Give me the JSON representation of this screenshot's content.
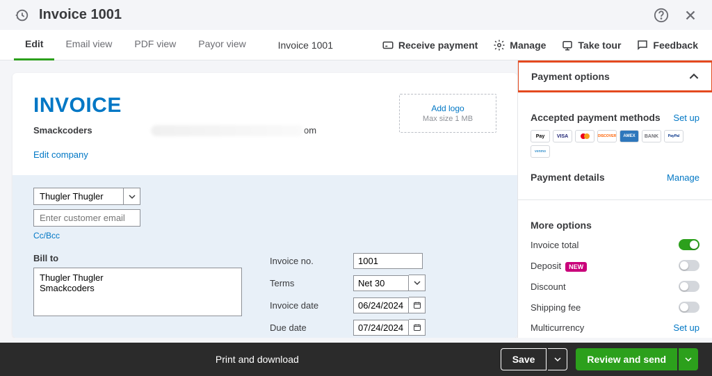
{
  "header": {
    "title": "Invoice 1001"
  },
  "tabs": {
    "items": [
      "Edit",
      "Email view",
      "PDF view",
      "Payor view"
    ],
    "center": "Invoice 1001",
    "actions": {
      "receive": "Receive payment",
      "manage": "Manage",
      "tour": "Take tour",
      "feedback": "Feedback"
    }
  },
  "invoice": {
    "title": "INVOICE",
    "company": "Smackcoders",
    "email_suffix": "om",
    "edit_company": "Edit company",
    "logo": {
      "add": "Add logo",
      "hint": "Max size  1 MB"
    },
    "customer": "Thugler Thugler",
    "email_placeholder": "Enter customer email",
    "ccbcc": "Cc/Bcc",
    "bill_to_label": "Bill to",
    "bill_to": "Thugler Thugler\nSmackcoders",
    "fields": {
      "invoice_no": {
        "label": "Invoice no.",
        "value": "1001"
      },
      "terms": {
        "label": "Terms",
        "value": "Net 30"
      },
      "invoice_date": {
        "label": "Invoice date",
        "value": "06/24/2024"
      },
      "due_date": {
        "label": "Due date",
        "value": "07/24/2024"
      }
    }
  },
  "panel": {
    "payment_options": "Payment options",
    "accepted": {
      "label": "Accepted payment methods",
      "setup": "Set up"
    },
    "payment_details": {
      "label": "Payment details",
      "manage": "Manage"
    },
    "more": "More options",
    "opts": {
      "total": "Invoice total",
      "deposit": "Deposit",
      "deposit_badge": "NEW",
      "discount": "Discount",
      "shipping": "Shipping fee",
      "multicurrency": "Multicurrency",
      "multicurrency_link": "Set up"
    },
    "pay_methods": [
      "ApplePay",
      "VISA",
      "MC",
      "DISCOVER",
      "AMEX",
      "BANK",
      "PayPal",
      "VENMO"
    ]
  },
  "footer": {
    "print": "Print and download",
    "save": "Save",
    "review": "Review and send"
  }
}
